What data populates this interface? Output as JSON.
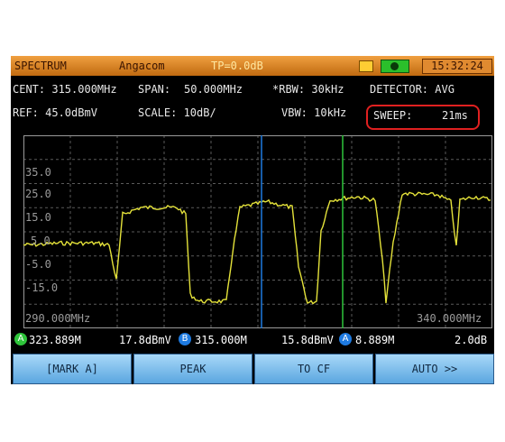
{
  "titlebar": {
    "mode": "SPECTRUM",
    "brand": "Angacom",
    "tp": "TP=0.0dB",
    "clock": "15:32:24"
  },
  "info": {
    "cent": "CENT: 315.000MHz",
    "span": "SPAN:",
    "span_val": "50.000MHz",
    "rbw": "*RBW: 30kHz",
    "detector": "DETECTOR: AVG",
    "ref": "REF:  45.0dBmV",
    "scale": "SCALE: 10dB/",
    "vbw": "VBW: 10kHz",
    "sweep_label": "SWEEP:",
    "sweep_val": "21ms"
  },
  "plot": {
    "y_labels": [
      "35.0",
      "25.0",
      "15.0",
      "5.0",
      "-5.0",
      "-15.0"
    ],
    "freq_start": "290.000MHz",
    "freq_stop": "340.000MHz",
    "trace_color": "#e4e23a",
    "marker_a_color": "#2ec43a",
    "marker_b_color": "#1e7ae0"
  },
  "markers": {
    "a_letter": "A",
    "a_value": "323.889M",
    "a_level": "17.8dBmV",
    "b_letter": "B",
    "b_value": "315.000M",
    "b_level": "15.8dBmV",
    "delta_letter": "A",
    "delta_value": "8.889M",
    "delta_level": "2.0dB"
  },
  "softkeys": [
    "[MARK A]",
    "PEAK",
    "TO CF",
    "AUTO >>"
  ]
}
